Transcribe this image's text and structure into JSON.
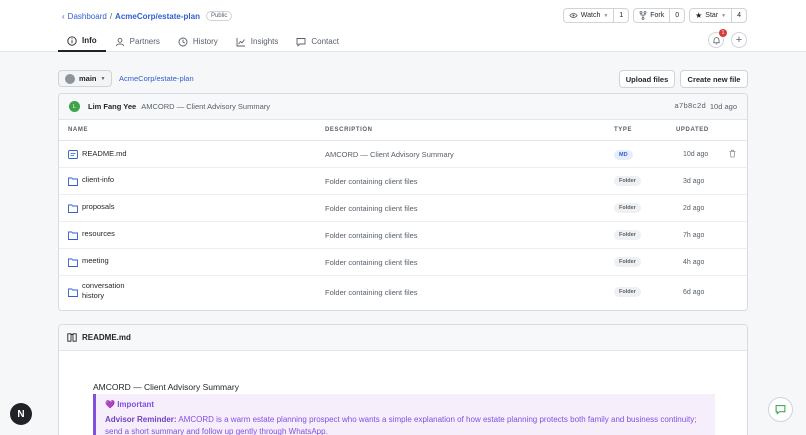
{
  "header": {
    "breadcrumb_root": "Dashboard",
    "separator": "/",
    "repo_path": "AcmeCorp/estate-plan",
    "visibility": "Public",
    "watch_label": "Watch",
    "watch_count": "1",
    "fork_label": "Fork",
    "fork_count": "0",
    "star_label": "Star",
    "star_count": "4",
    "notification_count": "1"
  },
  "tabs": [
    {
      "label": "Info",
      "icon": "info-icon",
      "active": true
    },
    {
      "label": "Partners",
      "icon": "user-icon"
    },
    {
      "label": "History",
      "icon": "history-icon"
    },
    {
      "label": "Insights",
      "icon": "chart-icon"
    },
    {
      "label": "Contact",
      "icon": "chat-icon"
    }
  ],
  "toolbar": {
    "branch": "main",
    "path_link": "AcmeCorp/estate-plan",
    "upload_label": "Upload files",
    "create_label": "Create new file"
  },
  "commit": {
    "avatar_initial": "L",
    "author": "Lim Fang Yee",
    "message": "AMCORD — Client Advisory Summary",
    "sha": "a7b8c2d",
    "time": "10d ago"
  },
  "table": {
    "headers": {
      "name": "NAME",
      "description": "DESCRIPTION",
      "type": "TYPE",
      "updated": "UPDATED"
    },
    "rows": [
      {
        "name": "README.md",
        "description": "AMCORD — Client Advisory Summary",
        "type": "MD",
        "updated": "10d ago",
        "icon": "file-icon"
      },
      {
        "name": "client-info",
        "description": "Folder containing client files",
        "type": "Folder",
        "updated": "3d ago",
        "icon": "folder-icon"
      },
      {
        "name": "proposals",
        "description": "Folder containing client files",
        "type": "Folder",
        "updated": "2d ago",
        "icon": "folder-icon"
      },
      {
        "name": "resources",
        "description": "Folder containing client files",
        "type": "Folder",
        "updated": "7h ago",
        "icon": "folder-icon"
      },
      {
        "name": "meeting",
        "description": "Folder containing client files",
        "type": "Folder",
        "updated": "4h ago",
        "icon": "folder-icon"
      },
      {
        "name_line1": "conversation",
        "name_line2": "history",
        "description": "Folder containing client files",
        "type": "Folder",
        "updated": "6d ago",
        "icon": "folder-icon"
      }
    ]
  },
  "readme": {
    "title": "README.md",
    "heading": "AMCORD — Client Advisory Summary",
    "callout_title": "Important",
    "callout_lead": "Advisor Reminder:",
    "callout_text": "AMCORD is a warm estate planning prospect who wants a simple explanation of how estate planning protects both family and business continuity; send a short summary and follow up gently through WhatsApp."
  },
  "fab": {
    "left_letter": "N"
  },
  "colors": {
    "link": "#2f5fd0",
    "accent_purple": "#8250df",
    "avatar_green": "#3fa34d",
    "badge_red": "#d93a3a"
  }
}
